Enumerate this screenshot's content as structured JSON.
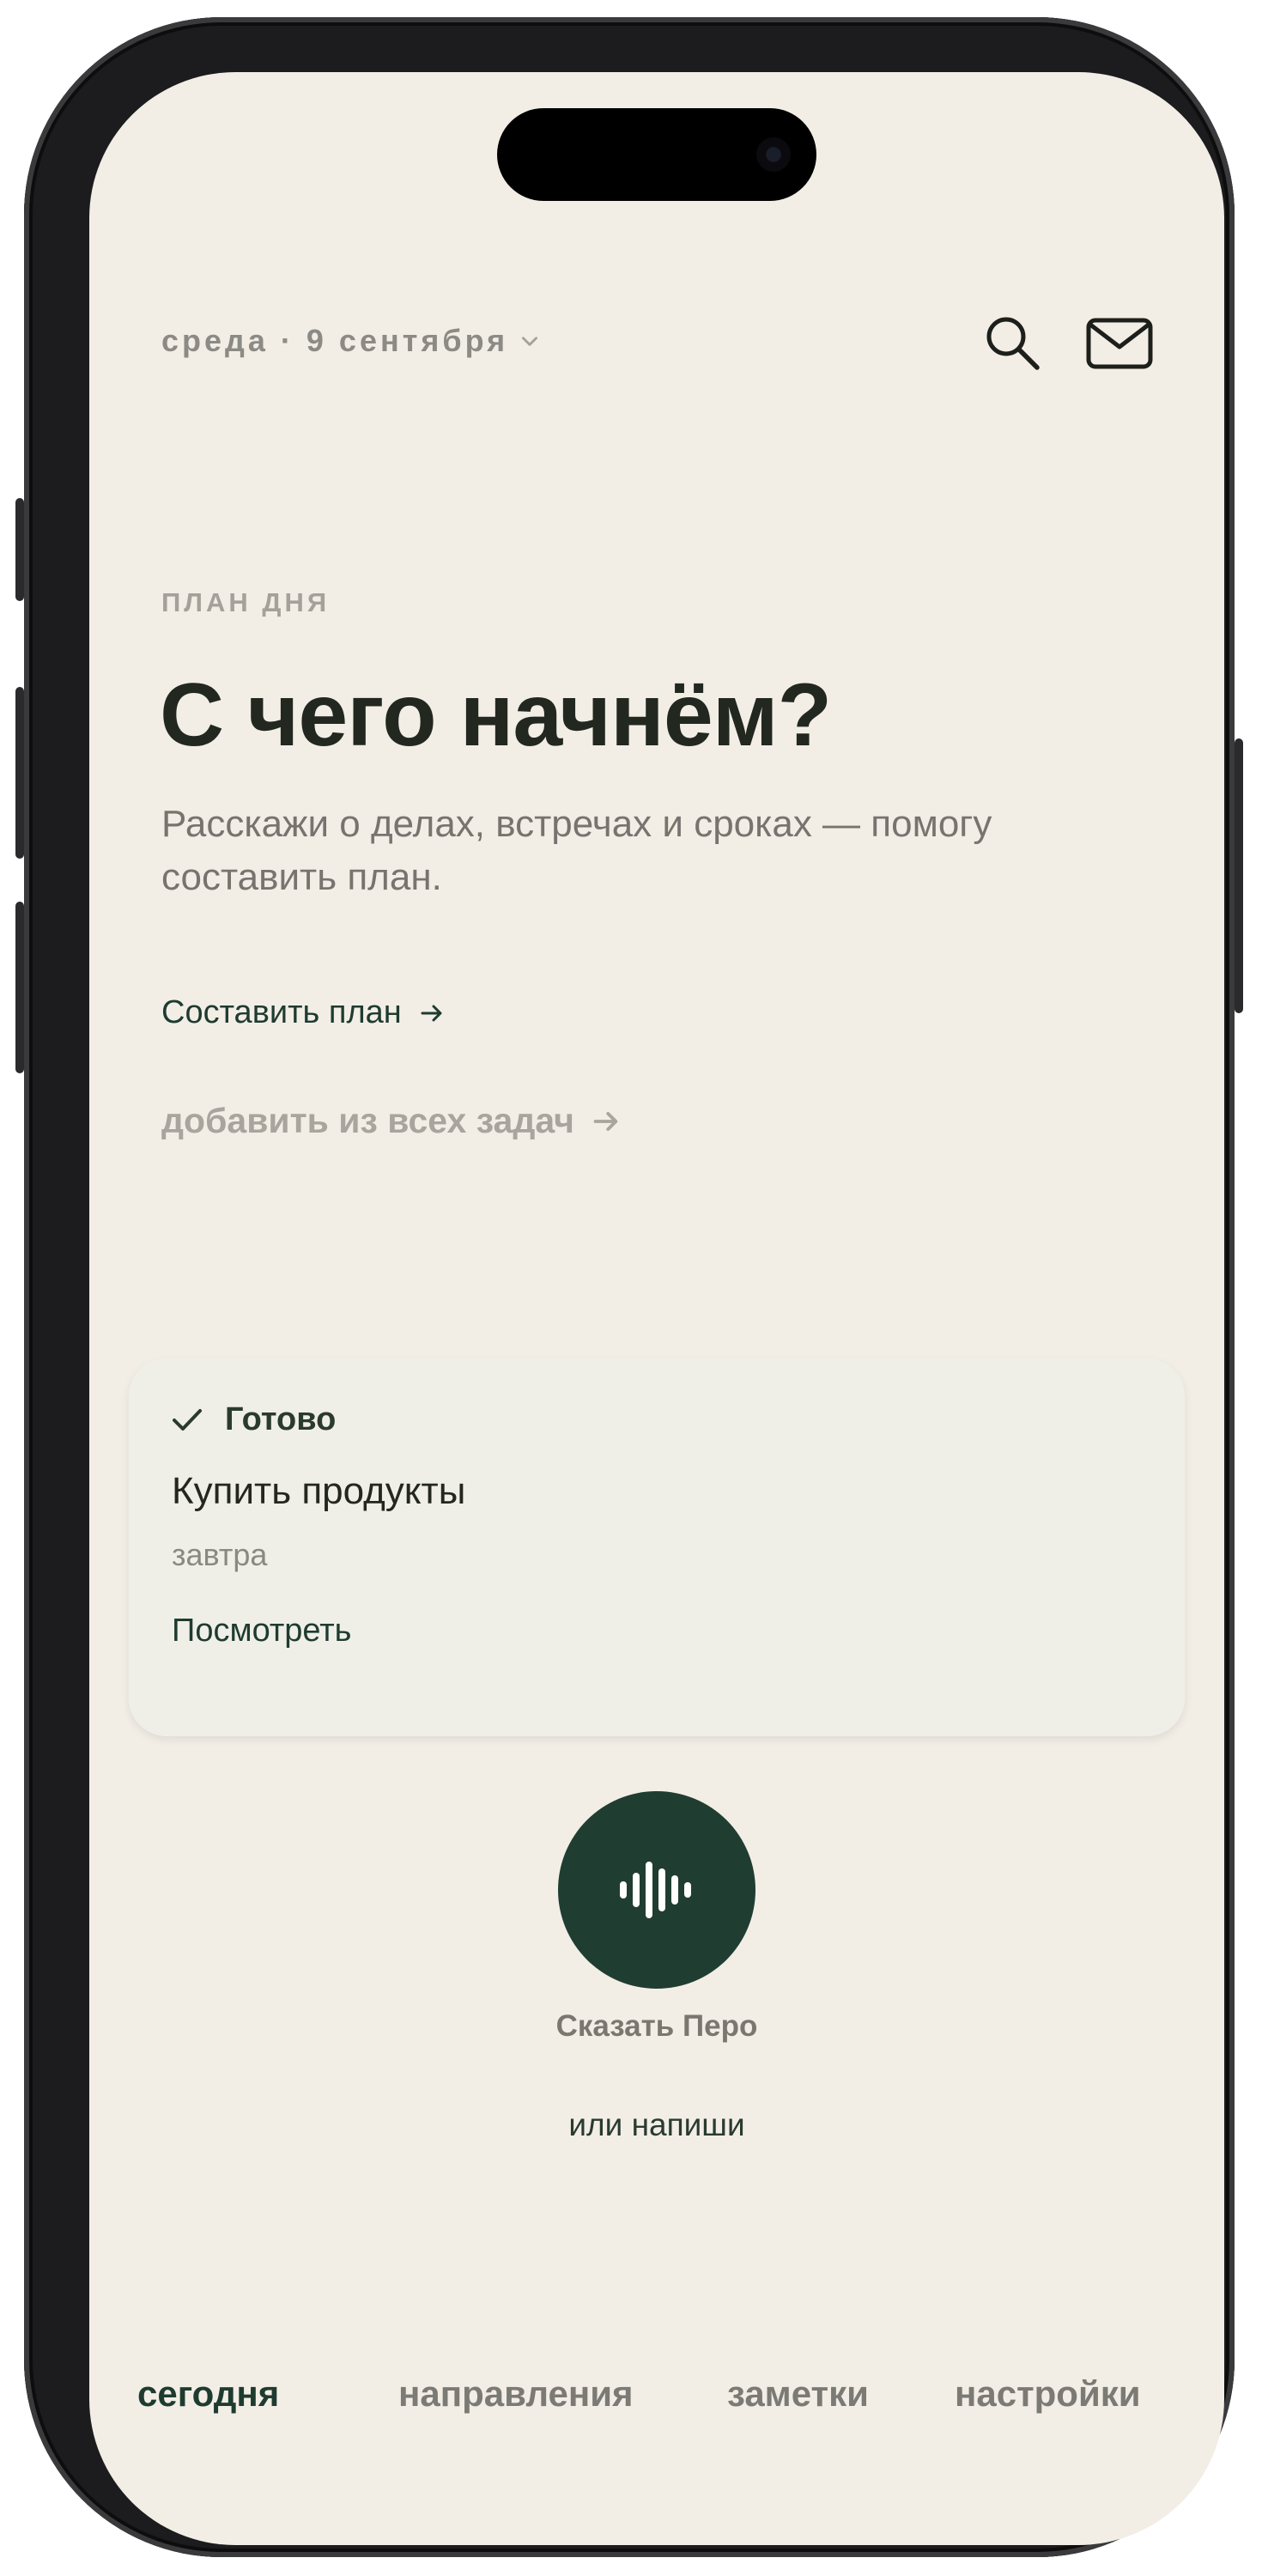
{
  "header": {
    "date_label": "среда · 9 сентября",
    "search_icon": "search-icon",
    "mail_icon": "mail-icon"
  },
  "plan": {
    "eyebrow": "ПЛАН ДНЯ",
    "title": "С чего начнём?",
    "subtitle": "Расскажи о делах, встречах и сроках — помогу составить план.",
    "primary_link": "Составить план",
    "secondary_link": "добавить из всех задач"
  },
  "card": {
    "status": "Готово",
    "task_title": "Купить продукты",
    "task_due": "завтра",
    "action": "Посмотреть"
  },
  "voice": {
    "button_label": "Сказать Перо",
    "alt_action": "или напиши",
    "icon": "waveform-icon"
  },
  "tabs": [
    {
      "label": "сегодня",
      "active": true
    },
    {
      "label": "направления",
      "active": false
    },
    {
      "label": "заметки",
      "active": false
    },
    {
      "label": "настройки",
      "active": false
    }
  ],
  "colors": {
    "background": "#f2eee6",
    "accent": "#203d32",
    "card": "#efefe8",
    "muted_text": "#8c8a84"
  }
}
